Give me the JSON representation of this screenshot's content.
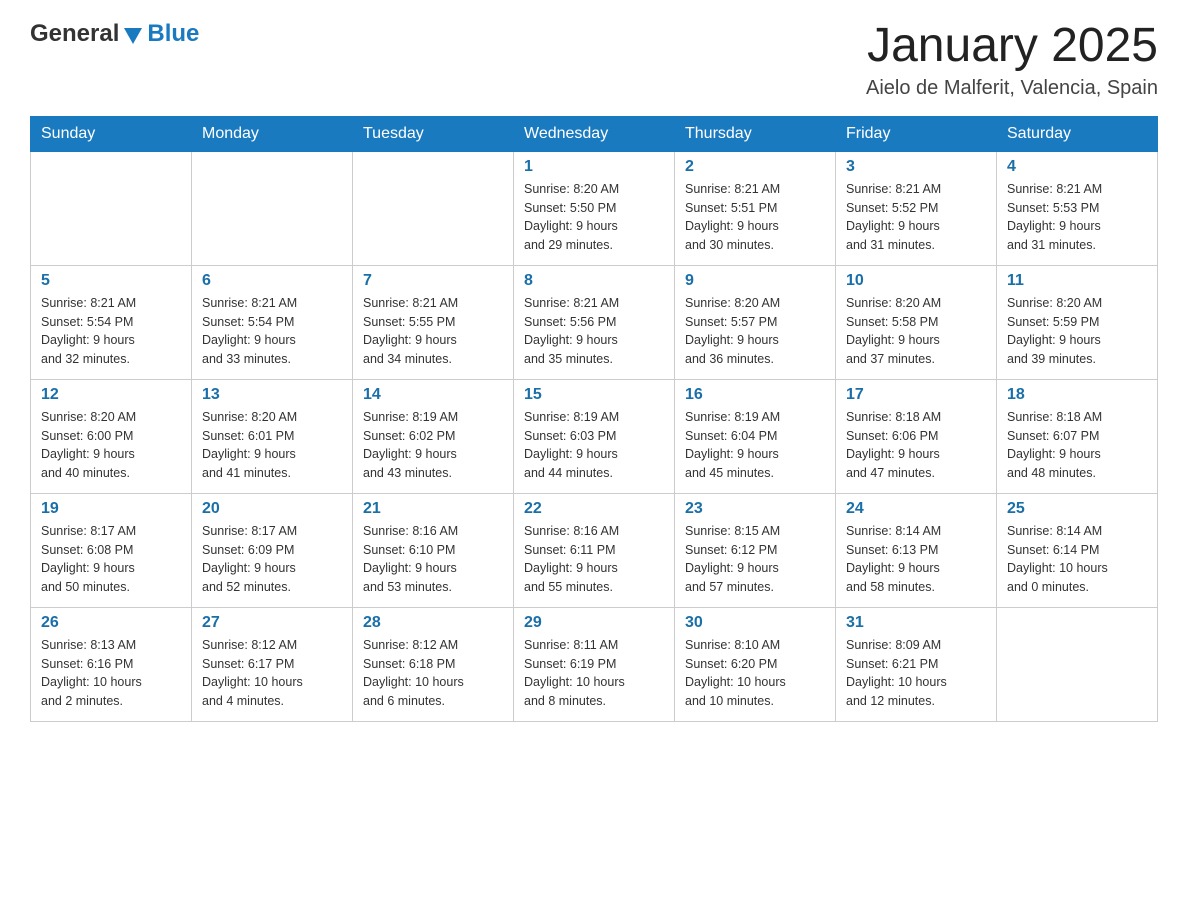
{
  "header": {
    "logo": {
      "general": "General",
      "blue": "Blue"
    },
    "title": "January 2025",
    "location": "Aielo de Malferit, Valencia, Spain"
  },
  "weekdays": [
    "Sunday",
    "Monday",
    "Tuesday",
    "Wednesday",
    "Thursday",
    "Friday",
    "Saturday"
  ],
  "weeks": [
    [
      {
        "day": "",
        "info": ""
      },
      {
        "day": "",
        "info": ""
      },
      {
        "day": "",
        "info": ""
      },
      {
        "day": "1",
        "info": "Sunrise: 8:20 AM\nSunset: 5:50 PM\nDaylight: 9 hours\nand 29 minutes."
      },
      {
        "day": "2",
        "info": "Sunrise: 8:21 AM\nSunset: 5:51 PM\nDaylight: 9 hours\nand 30 minutes."
      },
      {
        "day": "3",
        "info": "Sunrise: 8:21 AM\nSunset: 5:52 PM\nDaylight: 9 hours\nand 31 minutes."
      },
      {
        "day": "4",
        "info": "Sunrise: 8:21 AM\nSunset: 5:53 PM\nDaylight: 9 hours\nand 31 minutes."
      }
    ],
    [
      {
        "day": "5",
        "info": "Sunrise: 8:21 AM\nSunset: 5:54 PM\nDaylight: 9 hours\nand 32 minutes."
      },
      {
        "day": "6",
        "info": "Sunrise: 8:21 AM\nSunset: 5:54 PM\nDaylight: 9 hours\nand 33 minutes."
      },
      {
        "day": "7",
        "info": "Sunrise: 8:21 AM\nSunset: 5:55 PM\nDaylight: 9 hours\nand 34 minutes."
      },
      {
        "day": "8",
        "info": "Sunrise: 8:21 AM\nSunset: 5:56 PM\nDaylight: 9 hours\nand 35 minutes."
      },
      {
        "day": "9",
        "info": "Sunrise: 8:20 AM\nSunset: 5:57 PM\nDaylight: 9 hours\nand 36 minutes."
      },
      {
        "day": "10",
        "info": "Sunrise: 8:20 AM\nSunset: 5:58 PM\nDaylight: 9 hours\nand 37 minutes."
      },
      {
        "day": "11",
        "info": "Sunrise: 8:20 AM\nSunset: 5:59 PM\nDaylight: 9 hours\nand 39 minutes."
      }
    ],
    [
      {
        "day": "12",
        "info": "Sunrise: 8:20 AM\nSunset: 6:00 PM\nDaylight: 9 hours\nand 40 minutes."
      },
      {
        "day": "13",
        "info": "Sunrise: 8:20 AM\nSunset: 6:01 PM\nDaylight: 9 hours\nand 41 minutes."
      },
      {
        "day": "14",
        "info": "Sunrise: 8:19 AM\nSunset: 6:02 PM\nDaylight: 9 hours\nand 43 minutes."
      },
      {
        "day": "15",
        "info": "Sunrise: 8:19 AM\nSunset: 6:03 PM\nDaylight: 9 hours\nand 44 minutes."
      },
      {
        "day": "16",
        "info": "Sunrise: 8:19 AM\nSunset: 6:04 PM\nDaylight: 9 hours\nand 45 minutes."
      },
      {
        "day": "17",
        "info": "Sunrise: 8:18 AM\nSunset: 6:06 PM\nDaylight: 9 hours\nand 47 minutes."
      },
      {
        "day": "18",
        "info": "Sunrise: 8:18 AM\nSunset: 6:07 PM\nDaylight: 9 hours\nand 48 minutes."
      }
    ],
    [
      {
        "day": "19",
        "info": "Sunrise: 8:17 AM\nSunset: 6:08 PM\nDaylight: 9 hours\nand 50 minutes."
      },
      {
        "day": "20",
        "info": "Sunrise: 8:17 AM\nSunset: 6:09 PM\nDaylight: 9 hours\nand 52 minutes."
      },
      {
        "day": "21",
        "info": "Sunrise: 8:16 AM\nSunset: 6:10 PM\nDaylight: 9 hours\nand 53 minutes."
      },
      {
        "day": "22",
        "info": "Sunrise: 8:16 AM\nSunset: 6:11 PM\nDaylight: 9 hours\nand 55 minutes."
      },
      {
        "day": "23",
        "info": "Sunrise: 8:15 AM\nSunset: 6:12 PM\nDaylight: 9 hours\nand 57 minutes."
      },
      {
        "day": "24",
        "info": "Sunrise: 8:14 AM\nSunset: 6:13 PM\nDaylight: 9 hours\nand 58 minutes."
      },
      {
        "day": "25",
        "info": "Sunrise: 8:14 AM\nSunset: 6:14 PM\nDaylight: 10 hours\nand 0 minutes."
      }
    ],
    [
      {
        "day": "26",
        "info": "Sunrise: 8:13 AM\nSunset: 6:16 PM\nDaylight: 10 hours\nand 2 minutes."
      },
      {
        "day": "27",
        "info": "Sunrise: 8:12 AM\nSunset: 6:17 PM\nDaylight: 10 hours\nand 4 minutes."
      },
      {
        "day": "28",
        "info": "Sunrise: 8:12 AM\nSunset: 6:18 PM\nDaylight: 10 hours\nand 6 minutes."
      },
      {
        "day": "29",
        "info": "Sunrise: 8:11 AM\nSunset: 6:19 PM\nDaylight: 10 hours\nand 8 minutes."
      },
      {
        "day": "30",
        "info": "Sunrise: 8:10 AM\nSunset: 6:20 PM\nDaylight: 10 hours\nand 10 minutes."
      },
      {
        "day": "31",
        "info": "Sunrise: 8:09 AM\nSunset: 6:21 PM\nDaylight: 10 hours\nand 12 minutes."
      },
      {
        "day": "",
        "info": ""
      }
    ]
  ]
}
